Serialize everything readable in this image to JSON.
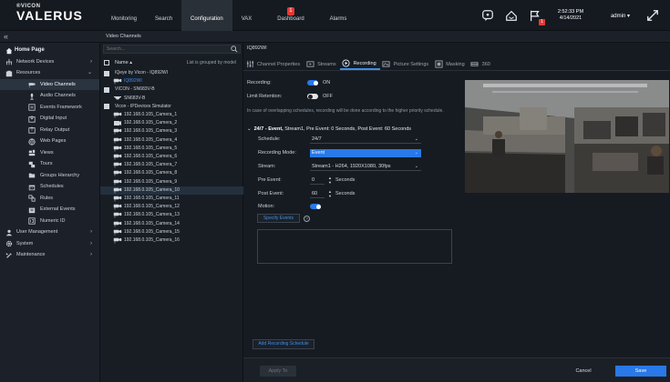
{
  "app": {
    "logo_small": "®VICON",
    "logo_big": "VALERUS"
  },
  "nav": [
    {
      "label": "Monitoring"
    },
    {
      "label": "Search"
    },
    {
      "label": "Configuration"
    },
    {
      "label": "VAX"
    },
    {
      "label": "Dashboard",
      "badge": "1"
    },
    {
      "label": "Alarms"
    }
  ],
  "topright": {
    "flag_badge": "1",
    "time": "2:52:33 PM",
    "date": "4/14/2021",
    "user": "admin ▾"
  },
  "breadcrumb": "Video Channels",
  "collapse_glyph": "«",
  "sidebar": {
    "home": "Home Page",
    "network_devices": "Network Devices",
    "resources": "Resources",
    "items": [
      "Video Channels",
      "Audio Channels",
      "Events Framework",
      "Digital Input",
      "Relay Output",
      "Web Pages",
      "Views",
      "Tours",
      "Groups Hierarchy",
      "Schedules",
      "Rules",
      "External Events",
      "Numeric ID"
    ],
    "user_management": "User Management",
    "system": "System",
    "maintenance": "Maintenance"
  },
  "tree": {
    "search_placeholder": "Search...",
    "name_header": "Name ▴",
    "grouped_note": "List is grouped by model",
    "rows": [
      {
        "label": "IQeye by Vicon - IQ892WI",
        "kind": "group"
      },
      {
        "label": "IQ892WI",
        "kind": "cam",
        "highlight": true
      },
      {
        "label": "VICON - SN683V-B",
        "kind": "group"
      },
      {
        "label": "SN683V-B",
        "kind": "dome"
      },
      {
        "label": "Vicon - IPDevices Simulator",
        "kind": "group"
      },
      {
        "label": "192.168.0.105_Camera_1",
        "kind": "cam"
      },
      {
        "label": "192.168.0.105_Camera_2",
        "kind": "cam2"
      },
      {
        "label": "192.168.0.105_Camera_3",
        "kind": "cam"
      },
      {
        "label": "192.168.0.105_Camera_4",
        "kind": "cam"
      },
      {
        "label": "192.168.0.105_Camera_5",
        "kind": "cam"
      },
      {
        "label": "192.168.0.105_Camera_6",
        "kind": "cam"
      },
      {
        "label": "192.168.0.105_Camera_7",
        "kind": "cam"
      },
      {
        "label": "192.168.0.105_Camera_8",
        "kind": "cam"
      },
      {
        "label": "192.168.0.105_Camera_9",
        "kind": "cam"
      },
      {
        "label": "192.168.0.105_Camera_10",
        "kind": "cam",
        "selected": true
      },
      {
        "label": "192.168.0.105_Camera_11",
        "kind": "cam"
      },
      {
        "label": "192.168.0.105_Camera_12",
        "kind": "cam"
      },
      {
        "label": "192.168.0.105_Camera_13",
        "kind": "cam"
      },
      {
        "label": "192.168.0.105_Camera_14",
        "kind": "cam"
      },
      {
        "label": "192.168.0.105_Camera_15",
        "kind": "cam"
      },
      {
        "label": "192.168.0.105_Camera_16",
        "kind": "cam"
      }
    ]
  },
  "main": {
    "title": "IQ892WI",
    "tabs": [
      "Channel Properties",
      "Streams",
      "Recording",
      "Picture Settings",
      "Masking",
      "360"
    ],
    "recording_label": "Recording:",
    "recording_state": "ON",
    "limit_label": "Limit Retention:",
    "limit_state": "OFF",
    "note": "In case of overlapping schedules, recording will be done according to the higher priority schedule.",
    "schedule_header_title": "24/7 - Event,",
    "schedule_header_rest": " Stream1,  Pre Event: 0 Seconds,  Post Event: 60 Seconds",
    "schedule_label": "Schedule:",
    "schedule_value": "24/7",
    "mode_label": "Recording Mode:",
    "mode_value": "Event",
    "stream_label": "Stream:",
    "stream_value": "Stream1 - H264, 1920X1080, 30fps",
    "pre_label": "Pre Event:",
    "pre_value": "0",
    "post_label": "Post Event:",
    "post_value": "60",
    "seconds": "Seconds",
    "motion_label": "Motion:",
    "specify_events": "Specify Events",
    "help": "?",
    "add_schedule": "Add Recording Schedule",
    "apply": "Apply To",
    "cancel": "Cancel",
    "save": "Save"
  },
  "colors": {
    "accent": "#2979e8",
    "badge": "#e53935"
  }
}
